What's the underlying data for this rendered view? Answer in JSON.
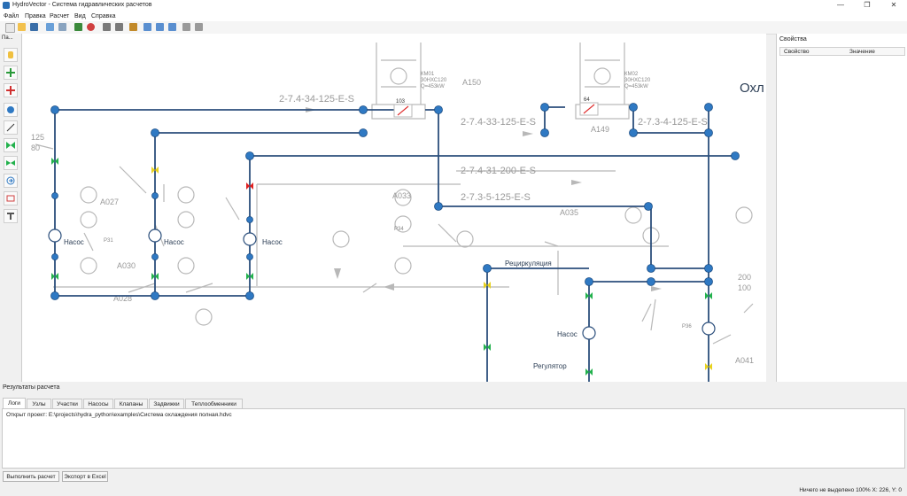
{
  "window": {
    "title": "HydroVector - Система гидравлических расчетов",
    "controls": [
      "—",
      "❐",
      "✕"
    ]
  },
  "menu": [
    "Файл",
    "Правка",
    "Расчет",
    "Вид",
    "Справка"
  ],
  "palette": {
    "title": "Па..."
  },
  "properties": {
    "title": "Свойства",
    "col_property": "Свойство",
    "col_value": "Значение"
  },
  "canvas": {
    "section_title": "Охл",
    "pipe_labels": [
      "2-7.4-34-125-E-S",
      "2-7.4-33-125-E-S",
      "2-7.3-4-125-E-S",
      "2-7.4-31-200-E-S",
      "2-7.3-5-125-E-S"
    ],
    "pump_label": "Насос",
    "recirc_label": "Рециркуляция",
    "regulator_label": "Регулятор",
    "hx_left": {
      "id": "103",
      "name": "КМ01",
      "model": "30НХС120",
      "q": "Q=453kW"
    },
    "hx_right": {
      "id": "64",
      "name": "КМ02",
      "model": "30НХС120",
      "q": "Q=453kW"
    },
    "valve_ids": [
      "A150",
      "A149",
      "A033",
      "A035",
      "A027",
      "A030",
      "A028",
      "A041"
    ],
    "pump_ids": [
      "P31",
      "P34",
      "P36"
    ],
    "dn_left": {
      "a": "125",
      "b": "80"
    },
    "dn_right": {
      "a": "200",
      "b": "100"
    }
  },
  "results": {
    "title": "Результаты расчета",
    "tabs": [
      "Логи",
      "Узлы",
      "Участки",
      "Насосы",
      "Клапаны",
      "Задвижки",
      "Теплообменники"
    ],
    "log_text": "Открыт проект: E:\\projects\\hydra_python\\examples\\Система охлаждения полная.hdvc"
  },
  "buttons": {
    "run": "Выполнить расчет",
    "export": "Экспорт в Excel"
  },
  "status": "Ничего не выделено  100%  X: 226, Y: 0",
  "colors": {
    "pipe": "#2c4f7c",
    "node": "#2f79c3",
    "valve_green": "#22b14c",
    "valve_yellow": "#e8d21d",
    "valve_red": "#e02020",
    "ghost": "#b8b8b8"
  }
}
